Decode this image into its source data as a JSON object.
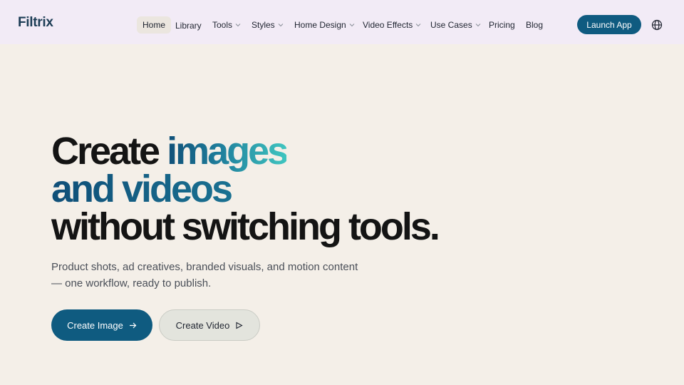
{
  "nav": {
    "logo": "Filtrix",
    "items": [
      {
        "label": "Home",
        "active": true,
        "has_dropdown": false
      },
      {
        "label": "Library",
        "active": false,
        "has_dropdown": false
      },
      {
        "label": "Tools",
        "active": false,
        "has_dropdown": true
      },
      {
        "label": "Styles",
        "active": false,
        "has_dropdown": true
      },
      {
        "label": "Home Design",
        "active": false,
        "has_dropdown": true
      },
      {
        "label": "Video Effects",
        "active": false,
        "has_dropdown": true
      },
      {
        "label": "Use Cases",
        "active": false,
        "has_dropdown": true
      },
      {
        "label": "Pricing",
        "active": false,
        "has_dropdown": false
      },
      {
        "label": "Blog",
        "active": false,
        "has_dropdown": false
      }
    ],
    "launch_label": "Launch App",
    "language_icon": "globe-icon"
  },
  "hero": {
    "line1_plain": "Create ",
    "line1_accent": "images",
    "line2_accent": "and videos",
    "line3": "without switching tools.",
    "subtitle_line1": "Product shots, ad creatives, branded visuals, and motion content",
    "subtitle_line2": "— one workflow, ready to publish.",
    "primary_button": "Create Image",
    "primary_icon": "arrow-right-icon",
    "secondary_button": "Create Video",
    "secondary_icon": "play-icon"
  },
  "colors": {
    "nav_background": "#f2ebf6",
    "page_background": "#f4efe8",
    "accent": "#0f5b80",
    "gradient_start": "#0f4f78",
    "gradient_end": "#3fc5c0"
  }
}
